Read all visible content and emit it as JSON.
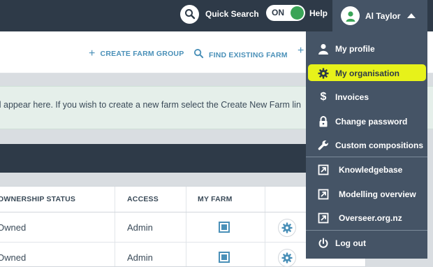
{
  "header": {
    "quick_search": "Quick Search",
    "toggle": "ON",
    "help": "Help",
    "user_name": "Al Taylor"
  },
  "actions": {
    "create_farm_group": "CREATE FARM GROUP",
    "find_existing_farm": "FIND EXISTING FARM"
  },
  "info": {
    "message": "ll appear here. If you wish to create a new farm select the Create New Farm lin"
  },
  "table": {
    "columns": [
      "OWNERSHIP STATUS",
      "ACCESS",
      "MY FARM"
    ],
    "rows": [
      {
        "ownership": "Owned",
        "access": "Admin"
      },
      {
        "ownership": "Owned",
        "access": "Admin"
      }
    ]
  },
  "menu": {
    "highlight_color": "#e7f21a",
    "items": [
      {
        "label": "My profile",
        "icon": "person-icon"
      },
      {
        "label": "My organisation",
        "icon": "gear-icon"
      },
      {
        "label": "Invoices",
        "icon": "dollar-icon"
      },
      {
        "label": "Change password",
        "icon": "lock-icon"
      },
      {
        "label": "Custom compositions",
        "icon": "wrench-icon"
      },
      {
        "label": "Knowledgebase",
        "icon": "external-link-icon"
      },
      {
        "label": "Modelling overview",
        "icon": "external-link-icon"
      },
      {
        "label": "Overseer.org.nz",
        "icon": "external-link-icon"
      },
      {
        "label": "Log out",
        "icon": "power-icon"
      }
    ]
  }
}
